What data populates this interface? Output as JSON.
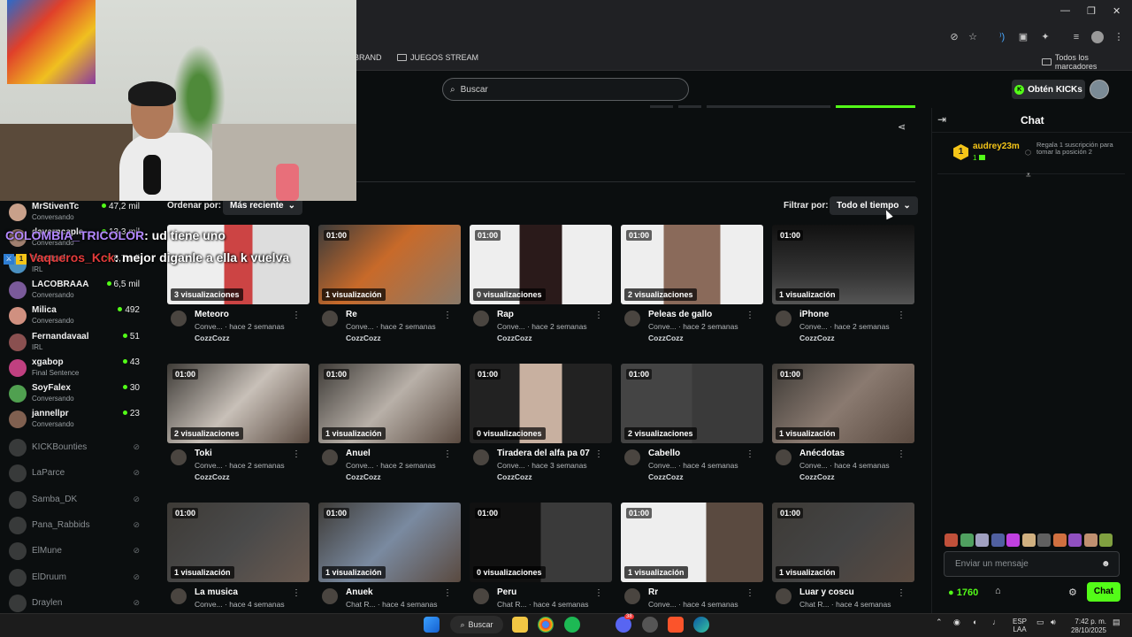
{
  "browser": {
    "bookmarks": [
      {
        "label": "BRAND"
      },
      {
        "label": "JUEGOS STREAM"
      }
    ],
    "all_bookmarks": "Todos los marcadores"
  },
  "header": {
    "search_placeholder": "Buscar",
    "get_kicks": "Obtén KICKs"
  },
  "overlay_chat": [
    {
      "user": "COLOMBIA_TRICOLOR",
      "text": ": ud tiene uno",
      "user_color": "#b388ff"
    },
    {
      "user": "Vaqueros_Kck",
      "text": ": mejor diganle a ella k vuelva",
      "user_color": "#e8e8e8"
    }
  ],
  "sidebar": {
    "channels": [
      {
        "name": "MrStivenTc",
        "category": "Conversando",
        "viewers": "47,2 mil"
      },
      {
        "name": "daverncaple",
        "category": "Conversando",
        "viewers": "13,3 mil"
      },
      {
        "name": "Westcol",
        "category": "IRL",
        "viewers": "8,7 mil"
      },
      {
        "name": "LACOBRAAA",
        "category": "Conversando",
        "viewers": "6,5 mil"
      },
      {
        "name": "Milica",
        "category": "Conversando",
        "viewers": "492"
      },
      {
        "name": "Fernandavaal",
        "category": "IRL",
        "viewers": "51"
      },
      {
        "name": "xgabop",
        "category": "Final Sentence",
        "viewers": "43"
      },
      {
        "name": "SoyFalex",
        "category": "Conversando",
        "viewers": "30"
      },
      {
        "name": "jannellpr",
        "category": "Conversando",
        "viewers": "23"
      }
    ],
    "offline": [
      "KICKBounties",
      "LaParce",
      "Samba_DK",
      "Pana_Rabbids",
      "ElMune",
      "ElDruum",
      "Draylen"
    ]
  },
  "content": {
    "sort_label": "Ordenar por:",
    "sort_value": "Más reciente",
    "filter_label": "Filtrar por:",
    "filter_value": "Todo el tiempo",
    "videos": [
      {
        "title": "Meteoro",
        "meta": "Conve... · hace 2 semanas",
        "channel": "CozzCozz",
        "duration": "",
        "views": "3 visualizaciones"
      },
      {
        "title": "Re",
        "meta": "Conve... · hace 2 semanas",
        "channel": "CozzCozz",
        "duration": "01:00",
        "views": "1 visualización"
      },
      {
        "title": "Rap",
        "meta": "Conve... · hace 2 semanas",
        "channel": "CozzCozz",
        "duration": "01:00",
        "views": "0 visualizaciones"
      },
      {
        "title": "Peleas de gallo",
        "meta": "Conve... · hace 2 semanas",
        "channel": "CozzCozz",
        "duration": "01:00",
        "views": "2 visualizaciones"
      },
      {
        "title": "iPhone",
        "meta": "Conve... · hace 2 semanas",
        "channel": "CozzCozz",
        "duration": "01:00",
        "views": "1 visualización"
      },
      {
        "title": "Toki",
        "meta": "Conve... · hace 2 semanas",
        "channel": "CozzCozz",
        "duration": "01:00",
        "views": "2 visualizaciones"
      },
      {
        "title": "Anuel",
        "meta": "Conve... · hace 2 semanas",
        "channel": "CozzCozz",
        "duration": "01:00",
        "views": "1 visualización"
      },
      {
        "title": "Tiradera del alfa pa 07",
        "meta": "Conve... · hace 3 semanas",
        "channel": "CozzCozz",
        "duration": "01:00",
        "views": "0 visualizaciones"
      },
      {
        "title": "Cabello",
        "meta": "Conve... · hace 4 semanas",
        "channel": "CozzCozz",
        "duration": "01:00",
        "views": "2 visualizaciones"
      },
      {
        "title": "Anécdotas",
        "meta": "Conve... · hace 4 semanas",
        "channel": "CozzCozz",
        "duration": "01:00",
        "views": "1 visualización"
      },
      {
        "title": "La musica",
        "meta": "Conve... · hace 4 semanas",
        "channel": "",
        "duration": "01:00",
        "views": "1 visualización"
      },
      {
        "title": "Anuek",
        "meta": "Chat R... · hace 4 semanas",
        "channel": "",
        "duration": "01:00",
        "views": "1 visualización"
      },
      {
        "title": "Peru",
        "meta": "Chat R... · hace 4 semanas",
        "channel": "",
        "duration": "01:00",
        "views": "0 visualizaciones"
      },
      {
        "title": "Rr",
        "meta": "Conve... · hace 4 semanas",
        "channel": "",
        "duration": "01:00",
        "views": "1 visualización"
      },
      {
        "title": "Luar y coscu",
        "meta": "Chat R... · hace 4 semanas",
        "channel": "",
        "duration": "01:00",
        "views": "1 visualización"
      }
    ]
  },
  "chat": {
    "title": "Chat",
    "gifter": {
      "rank": "1",
      "name": "audrey23m",
      "count": "1",
      "promo": "Regala 1 suscripción para tomar la posición 2"
    },
    "input_placeholder": "Enviar un mensaje",
    "kicks_balance": "1760",
    "send_label": "Chat"
  },
  "taskbar": {
    "search": "Buscar",
    "lang": "ESP",
    "lang2": "LAA",
    "time": "7:42 p. m.",
    "date": "28/10/2025",
    "discord_badge": "38"
  },
  "colors": {
    "accent": "#53fc18",
    "bg": "#0b0e0f"
  }
}
